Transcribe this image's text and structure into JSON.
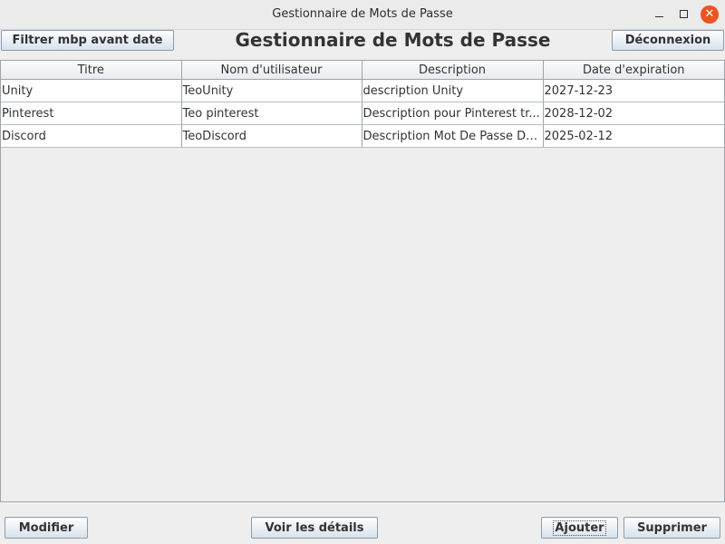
{
  "window": {
    "title": "Gestionnaire de Mots de Passe",
    "close_symbol": "✕"
  },
  "header": {
    "filter_label": "Filtrer mbp avant date",
    "title": "Gestionnaire de Mots de Passe",
    "logout_label": "Déconnexion"
  },
  "table": {
    "columns": [
      "Titre",
      "Nom d'utilisateur",
      "Description",
      "Date d'expiration"
    ],
    "rows": [
      [
        "Unity",
        "TeoUnity",
        "description Unity",
        "2027-12-23"
      ],
      [
        "Pinterest",
        "Teo pinterest",
        "Description pour Pinterest tr...",
        "2028-12-02"
      ],
      [
        "Discord",
        "TeoDiscord",
        "Description Mot De Passe Dis...",
        "2025-02-12"
      ]
    ]
  },
  "footer": {
    "modify_label": "Modifier",
    "details_label": "Voir les détails",
    "add_label": "Ajouter",
    "delete_label": "Supprimer"
  },
  "colors": {
    "close_button": "#e95420",
    "button_gradient_top": "#fdfefe",
    "button_gradient_bottom": "#d8e2ec",
    "background": "#eeeeee"
  }
}
